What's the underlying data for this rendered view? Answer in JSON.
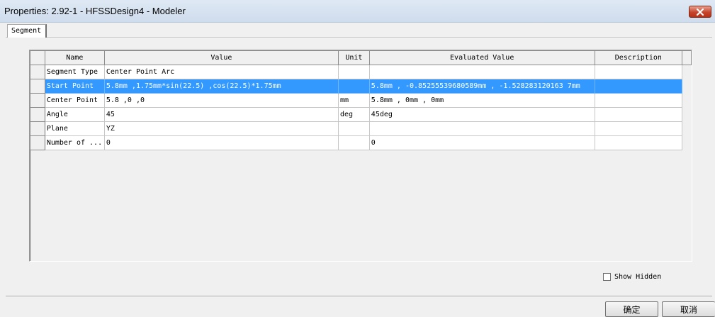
{
  "window": {
    "title": "Properties: 2.92-1 - HFSSDesign4 - Modeler"
  },
  "tabs": [
    {
      "label": "Segment"
    }
  ],
  "grid": {
    "columns": [
      "Name",
      "Value",
      "Unit",
      "Evaluated Value",
      "Description"
    ],
    "rows": [
      {
        "name": "Segment Type",
        "value": "Center Point Arc",
        "unit": "",
        "evaluated": "",
        "description": ""
      },
      {
        "name": "Start Point",
        "value": "5.8mm ,1.75mm*sin(22.5) ,cos(22.5)*1.75mm",
        "unit": "",
        "evaluated": "5.8mm , -0.85255539680589mm , -1.528283120163 7mm",
        "description": ""
      },
      {
        "name": "Center Point",
        "value": "5.8 ,0 ,0",
        "unit": "mm",
        "evaluated": "5.8mm , 0mm , 0mm",
        "description": ""
      },
      {
        "name": "Angle",
        "value": "45",
        "unit": "deg",
        "evaluated": "45deg",
        "description": ""
      },
      {
        "name": "Plane",
        "value": "YZ",
        "unit": "",
        "evaluated": "",
        "description": ""
      },
      {
        "name": "Number of ...",
        "value": "0",
        "unit": "",
        "evaluated": "0",
        "description": ""
      }
    ],
    "selected_row_index": 1
  },
  "options": {
    "show_hidden_label": "Show Hidden",
    "show_hidden_checked": false
  },
  "buttons": {
    "ok": "确定",
    "cancel": "取消"
  },
  "colors": {
    "selection": "#3399ff",
    "close_button": "#c6452c"
  }
}
